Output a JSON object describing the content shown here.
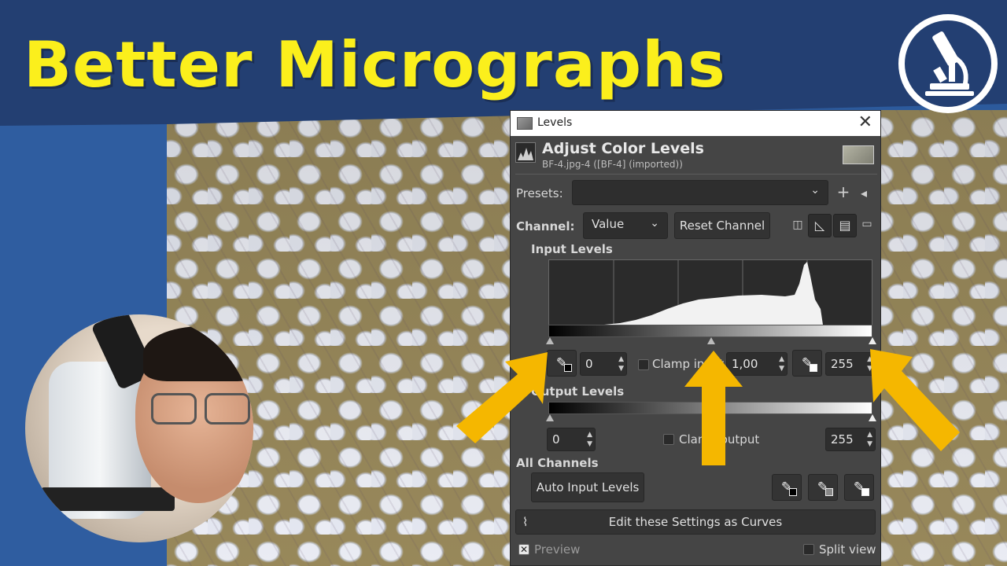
{
  "banner": {
    "title": "Better Micrographs",
    "title_color": "#fbef1c",
    "background_color": "#233f72",
    "logo_icon": "microscope-icon"
  },
  "dialog": {
    "window_title": "Levels",
    "header_title": "Adjust Color Levels",
    "header_subtitle": "BF-4.jpg-4 ([BF-4] (imported))",
    "presets_label": "Presets:",
    "presets_value": "",
    "channel_label": "Channel:",
    "channel_value": "Value",
    "reset_channel_label": "Reset Channel",
    "input_levels_label": "Input Levels",
    "input_low": "0",
    "clamp_input_label": "Clamp input",
    "input_gamma": "1,00",
    "input_high": "255",
    "output_levels_label": "Output Levels",
    "output_low": "0",
    "clamp_output_label": "Clamp output",
    "output_high": "255",
    "all_channels_label": "All Channels",
    "auto_input_levels_label": "Auto Input Levels",
    "edit_as_curves_label": "Edit these Settings as Curves",
    "preview_label": "Preview",
    "preview_checked": true,
    "split_view_label": "Split view",
    "split_view_checked": false
  },
  "annotations": {
    "arrow_color": "#f5b700",
    "arrow_count": 3
  }
}
